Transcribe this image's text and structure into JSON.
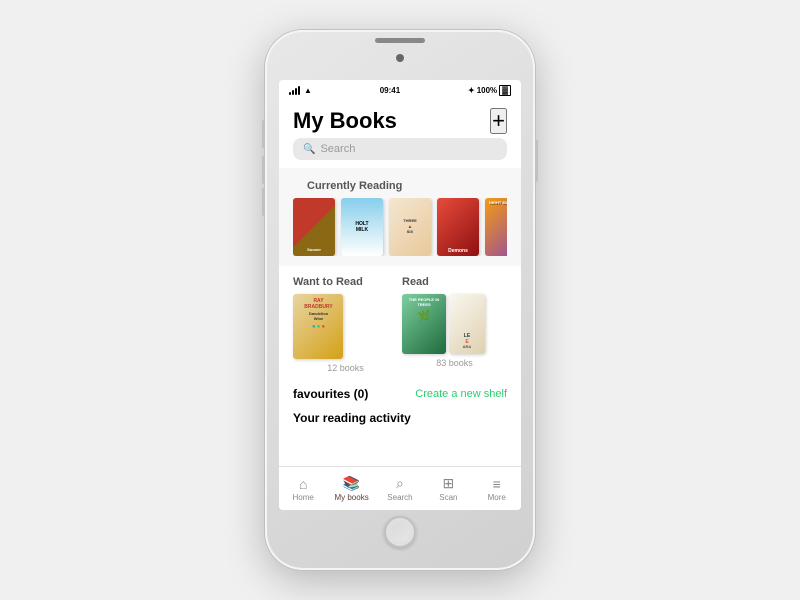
{
  "phone": {
    "status_bar": {
      "time": "09:41",
      "signal": "●●●",
      "wifi": "WiFi",
      "bluetooth": "BT",
      "battery": "100%"
    },
    "header": {
      "title": "My Books",
      "add_button": "+"
    },
    "search": {
      "placeholder": "Search"
    },
    "currently_reading": {
      "section_title": "Currently Reading",
      "books": [
        {
          "id": "book-1",
          "title": "Sooner",
          "color_class": "book-1"
        },
        {
          "id": "book-2",
          "title": "Holt Milk",
          "color_class": "book-2"
        },
        {
          "id": "book-3",
          "title": "Three Six",
          "color_class": "book-3"
        },
        {
          "id": "book-4",
          "title": "Demons",
          "color_class": "book-4"
        },
        {
          "id": "book-5",
          "title": "Night Manager",
          "color_class": "book-5"
        },
        {
          "id": "book-6",
          "title": "...",
          "color_class": "book-6"
        }
      ]
    },
    "want_to_read": {
      "section_title": "Want to Read",
      "books": [
        {
          "id": "want-1",
          "title": "Ray Bradbury Dandelion Wine",
          "color_class": "book-want-1"
        },
        {
          "id": "want-2",
          "title": "",
          "color_class": "book-want-2"
        }
      ],
      "count": "12 books"
    },
    "read": {
      "section_title": "Read",
      "books": [
        {
          "id": "read-1",
          "title": "The People in Trees",
          "color_class": "book-read-1"
        },
        {
          "id": "read-2",
          "title": "LE ARA",
          "color_class": "book-read-2"
        }
      ],
      "count": "83 books"
    },
    "favourites": {
      "label": "favourites (0)",
      "create_shelf": "Create a new shelf"
    },
    "reading_activity": {
      "label": "Your reading activity"
    },
    "bottom_nav": {
      "items": [
        {
          "id": "home",
          "icon": "⌂",
          "label": "Home",
          "active": false
        },
        {
          "id": "my-books",
          "icon": "📚",
          "label": "My books",
          "active": true
        },
        {
          "id": "search",
          "icon": "🔍",
          "label": "Search",
          "active": false
        },
        {
          "id": "scan",
          "icon": "⊞",
          "label": "Scan",
          "active": false
        },
        {
          "id": "more",
          "icon": "≡",
          "label": "More",
          "active": false
        }
      ]
    }
  }
}
